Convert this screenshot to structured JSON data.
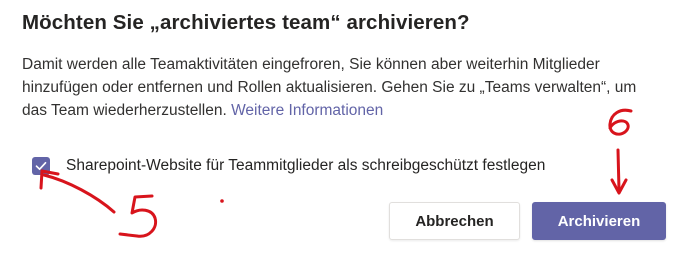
{
  "dialog": {
    "title": "Möchten Sie „archiviertes team“ archivieren?",
    "body_text": "Damit werden alle Teamaktivitäten eingefroren, Sie können aber weiterhin Mitglieder hinzufügen oder entfernen und Rollen aktualisieren. Gehen Sie zu „Teams verwalten“, um das Team wiederherzustellen. ",
    "link_text": "Weitere Informationen",
    "checkbox": {
      "label": "Sharepoint-Website für Teammitglieder als schreibgeschützt festlegen",
      "checked": true
    },
    "buttons": {
      "cancel_label": "Abbrechen",
      "archive_label": "Archivieren"
    }
  },
  "annotations": {
    "marker_5": "5",
    "marker_6": "6",
    "ink_color": "#d8141c"
  },
  "colors": {
    "accent": "#6264a7",
    "text": "#252423",
    "border": "#e1dfdd"
  }
}
